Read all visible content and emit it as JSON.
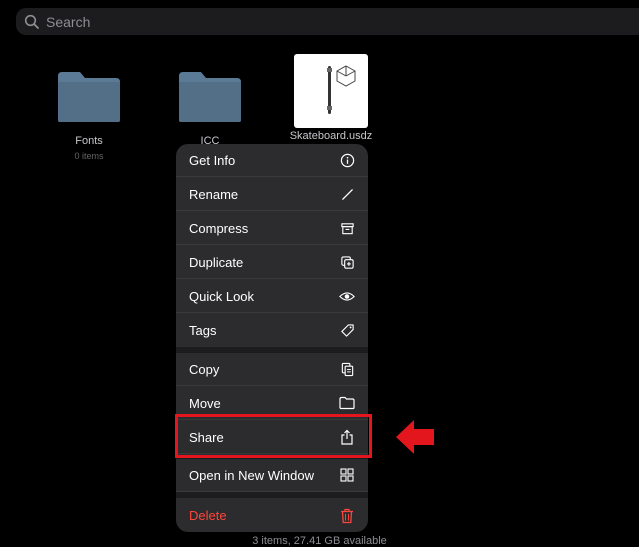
{
  "search": {
    "placeholder": "Search"
  },
  "files": [
    {
      "name": "Fonts",
      "subtitle": "0 items"
    },
    {
      "name": "ICC",
      "subtitle": ""
    },
    {
      "name": "Skateboard.usdz",
      "subtitle": ""
    }
  ],
  "menu": {
    "items": [
      {
        "label": "Get Info",
        "icon": "info-circle-icon"
      },
      {
        "label": "Rename",
        "icon": "pencil-icon"
      },
      {
        "label": "Compress",
        "icon": "archive-box-icon"
      },
      {
        "label": "Duplicate",
        "icon": "duplicate-icon"
      },
      {
        "label": "Quick Look",
        "icon": "eye-icon"
      },
      {
        "label": "Tags",
        "icon": "tag-icon"
      },
      {
        "label": "Copy",
        "icon": "copy-document-icon"
      },
      {
        "label": "Move",
        "icon": "folder-icon"
      },
      {
        "label": "Share",
        "icon": "share-icon"
      },
      {
        "label": "Open in New Window",
        "icon": "grid-window-icon"
      },
      {
        "label": "Delete",
        "icon": "trash-icon"
      }
    ]
  },
  "footer": {
    "status": "3 items, 27.41 GB available"
  },
  "colors": {
    "highlight": "#e3151d",
    "danger": "#ff453a",
    "folder": "#5b7a95"
  }
}
